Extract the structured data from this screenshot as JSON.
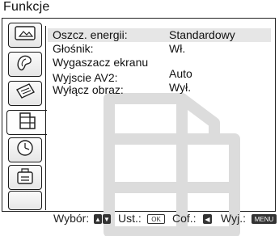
{
  "window": {
    "title": "Funkcje"
  },
  "sidebar": {
    "tabs": [
      {
        "icon": "picture-icon"
      },
      {
        "icon": "sound-icon"
      },
      {
        "icon": "screen-icon"
      },
      {
        "icon": "features-icon",
        "active": true
      },
      {
        "icon": "timer-icon"
      },
      {
        "icon": "setup-icon"
      }
    ]
  },
  "menu": {
    "rows": [
      {
        "label": "Oszcz. energii:",
        "value": "Standardowy",
        "selected": true
      },
      {
        "label": "Głośnik:",
        "value": "Wł."
      },
      {
        "label": "Wygaszacz ekranu",
        "value": ""
      },
      {
        "label": "Wyjscie AV2:",
        "value": "Auto"
      },
      {
        "label": "Wyłącz obraz:",
        "value": "Wył."
      }
    ]
  },
  "footer": {
    "select_label": "Wybór:",
    "ok_label": "Ust.:",
    "ok_key": "OK",
    "back_label": "Cof.:",
    "exit_label": "Wyj.:",
    "exit_key": "MENU"
  }
}
